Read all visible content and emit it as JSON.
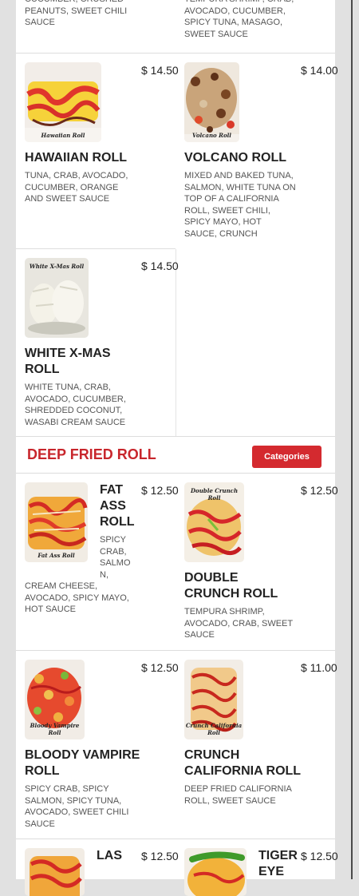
{
  "colors": {
    "accent": "#d42a2f",
    "section_title": "#c8262c",
    "background": "#e1e1e1"
  },
  "top_partial": {
    "left_desc": "CUCUMBER, CRUSHED PEANUTS, SWEET CHILI SAUCE",
    "right_desc": "TEMPURA SHRIMP, CRAB, AVOCADO, CUCUMBER, SPICY TUNA, MASAGO, SWEET SAUCE"
  },
  "items": {
    "hawaiian": {
      "name": "HAWAIIAN ROLL",
      "price": "$ 14.50",
      "desc": "TUNA, CRAB, AVOCADO, CUCUMBER, ORANGE AND SWEET SAUCE",
      "img_caption": "Hawaiian Roll"
    },
    "volcano": {
      "name": "VOLCANO ROLL",
      "price": "$ 14.00",
      "desc": "MIXED AND BAKED TUNA, SALMON, WHITE TUNA ON TOP OF A CALIFORNIA ROLL, SWEET CHILI, SPICY MAYO, HOT SAUCE, CRUNCH",
      "img_caption": "Volcano Roll"
    },
    "white_xmas": {
      "name": "WHITE X-MAS ROLL",
      "price": "$ 14.50",
      "desc": "WHITE TUNA, CRAB, AVOCADO, CUCUMBER, SHREDDED COCONUT, WASABI CREAM SAUCE",
      "img_caption": "White X-Mas Roll"
    },
    "fat_ass": {
      "name": "FAT ASS ROLL",
      "price": "$ 12.50",
      "desc_side": "SPICY CRAB, SALMON,",
      "desc_full": "CREAM CHEESE, AVOCADO, SPICY MAYO, HOT SAUCE",
      "img_caption": "Fat Ass Roll"
    },
    "double_crunch": {
      "name": "DOUBLE CRUNCH ROLL",
      "price": "$ 12.50",
      "desc": "TEMPURA SHRIMP, AVOCADO, CRAB, SWEET SAUCE",
      "img_caption": "Double Crunch Roll"
    },
    "bloody_vampire": {
      "name": "BLOODY VAMPIRE ROLL",
      "price": "$ 12.50",
      "desc": "SPICY CRAB, SPICY SALMON, SPICY TUNA, AVOCADO, SWEET CHILI SAUCE",
      "img_caption": "Bloody Vampire Roll"
    },
    "crunch_california": {
      "name": "CRUNCH CALIFORNIA ROLL",
      "price": "$ 11.00",
      "desc": "DEEP FRIED CALIFORNIA ROLL, SWEET SAUCE",
      "img_caption": "Crunch California Roll"
    },
    "las": {
      "name": "LAS",
      "price": "$ 12.50"
    },
    "tiger_eye": {
      "name": "TIGER EYE",
      "price": "$ 12.50"
    }
  },
  "section": {
    "title": "DEEP FRIED ROLL",
    "categories_button": "Categories"
  }
}
